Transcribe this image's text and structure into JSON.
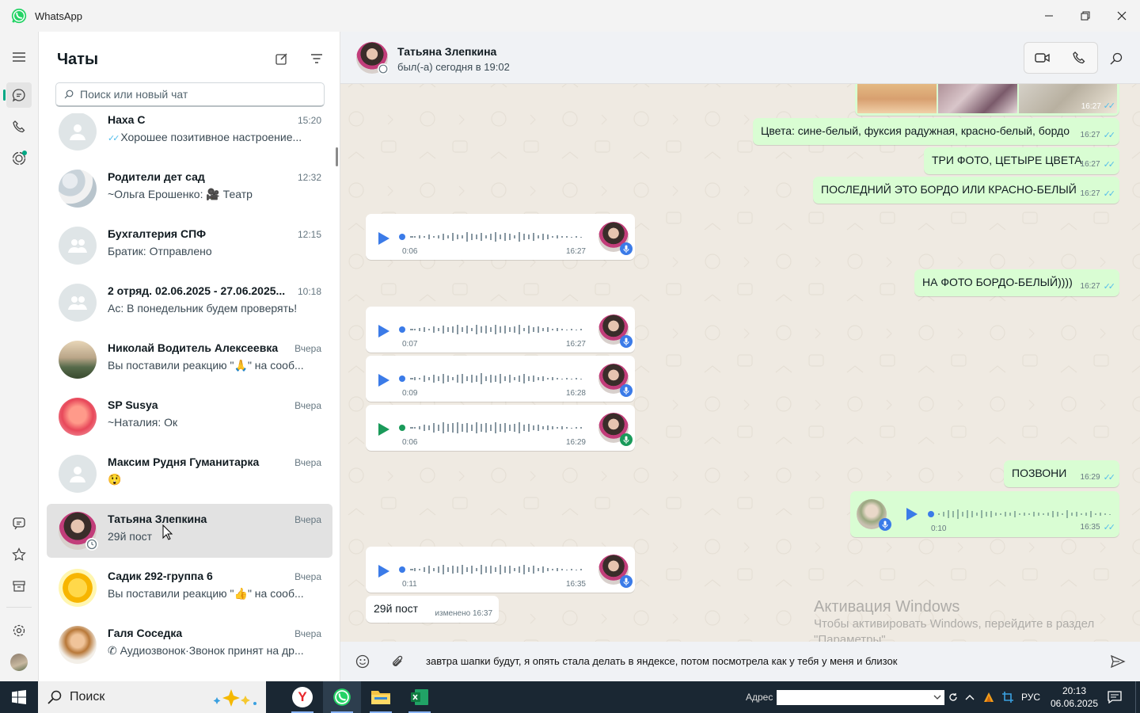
{
  "window": {
    "title": "WhatsApp",
    "minimize_icon": "minimize-icon",
    "maximize_icon": "restore-icon",
    "close_icon": "close-icon"
  },
  "rail": {
    "top": [
      "menu-icon",
      "chats-icon",
      "calls-icon",
      "status-icon"
    ],
    "bottom": [
      "communities-icon",
      "starred-icon",
      "archive-icon",
      "settings-icon",
      "profile-avatar"
    ]
  },
  "sidebar": {
    "title": "Чаты",
    "search_placeholder": "Поиск или новый чат",
    "chats": [
      {
        "name": "Наха С",
        "time": "15:20",
        "preview": "Хорошее позитивное настроение..."
      },
      {
        "name": "Родители дет сад",
        "time": "12:32",
        "preview": "~Ольга Ерошенко: 🎥 Театр"
      },
      {
        "name": "Бухгалтерия СПФ",
        "time": "12:15",
        "preview": "Братик: Отправлено"
      },
      {
        "name": "2 отряд. 02.06.2025 - 27.06.2025...",
        "time": "10:18",
        "preview": "Ас: В понедельник будем проверять!"
      },
      {
        "name": "Николай Водитель Алексеевка",
        "time": "Вчера",
        "preview": "Вы поставили реакцию \"🙏\" на сооб..."
      },
      {
        "name": "SP Susya",
        "time": "Вчера",
        "preview": "~Наталия: Ок"
      },
      {
        "name": "Максим Рудня Гуманитарка",
        "time": "Вчера",
        "preview": "😲"
      },
      {
        "name": "Татьяна Злепкина",
        "time": "Вчера",
        "preview": "29й пост"
      },
      {
        "name": "Садик 292-группа 6",
        "time": "Вчера",
        "preview": "Вы поставили реакцию \"👍\" на сооб..."
      },
      {
        "name": "Галя Соседка",
        "time": "Вчера",
        "preview": "Аудиозвонок·Звонок принят на др..."
      }
    ]
  },
  "chat": {
    "name": "Татьяна Злепкина",
    "status": "был(-а) сегодня в 19:02",
    "photo_time": "16:27",
    "messages": [
      {
        "dir": "out",
        "text": "Цвета: сине-белый, фуксия радужная, красно-белый, бордо",
        "time": "16:27"
      },
      {
        "dir": "out",
        "text": "ТРИ ФОТО, ЦЕТЫРЕ ЦВЕТА",
        "time": "16:27"
      },
      {
        "dir": "out",
        "text": "ПОСЛЕДНИЙ ЭТО БОРДО ИЛИ КРАСНО-БЕЛЫЙ",
        "time": "16:27"
      },
      {
        "dir": "in",
        "voice": true,
        "duration": "0:06",
        "time": "16:27"
      },
      {
        "dir": "out",
        "text": "НА ФОТО БОРДО-БЕЛЫЙ))))",
        "time": "16:27"
      },
      {
        "dir": "in",
        "voice": true,
        "duration": "0:07",
        "time": "16:27"
      },
      {
        "dir": "in",
        "voice": true,
        "duration": "0:09",
        "time": "16:28"
      },
      {
        "dir": "in",
        "voice": true,
        "duration": "0:06",
        "time": "16:29"
      },
      {
        "dir": "out",
        "text": "ПОЗВОНИ",
        "time": "16:29"
      },
      {
        "dir": "out",
        "voice": true,
        "duration": "0:10",
        "time": "16:35"
      },
      {
        "dir": "in",
        "voice": true,
        "duration": "0:11",
        "time": "16:35"
      },
      {
        "dir": "in",
        "text": "29й пост",
        "time": "изменено 16:37"
      }
    ],
    "draft": "завтра шапки будут, я опять стала делать в яндексе, потом посмотрела как у тебя у меня и близок"
  },
  "watermark": {
    "line1": "Активация Windows",
    "line2": "Чтобы активировать Windows, перейдите в раздел",
    "line3": "\"Параметры\"."
  },
  "taskbar": {
    "search_label": "Поиск",
    "address_label": "Адрес",
    "language": "РУС",
    "time": "20:13",
    "date": "06.06.2025",
    "apps": [
      "yandex-browser-icon",
      "whatsapp-icon",
      "file-explorer-icon",
      "excel-icon"
    ]
  },
  "colors": {
    "accent": "#00a884",
    "outgoing": "#d9fdd3",
    "incoming": "#ffffff",
    "read_ticks": "#53bdeb"
  }
}
